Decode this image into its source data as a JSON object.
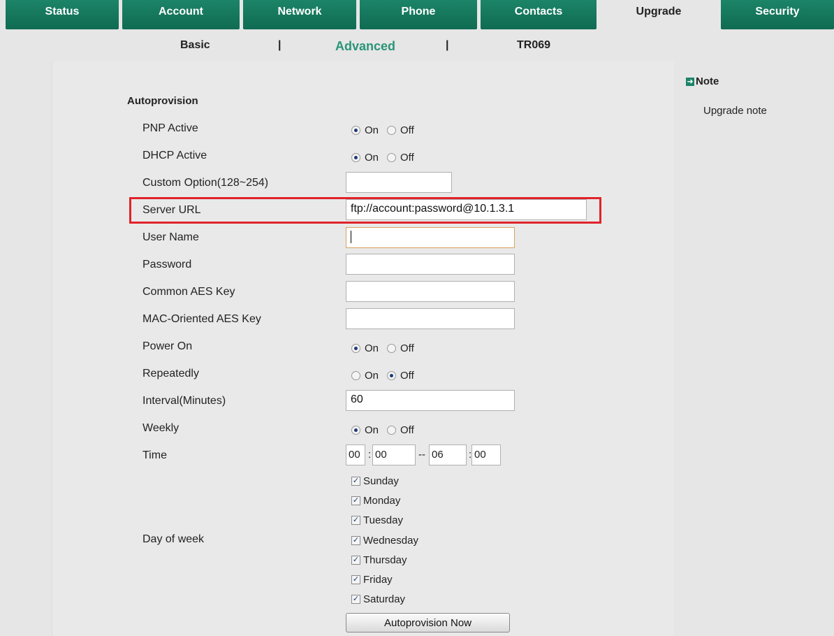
{
  "tabs": [
    {
      "label": "Status"
    },
    {
      "label": "Account"
    },
    {
      "label": "Network"
    },
    {
      "label": "Phone"
    },
    {
      "label": "Contacts"
    },
    {
      "label": "Upgrade",
      "active": true
    },
    {
      "label": "Security"
    }
  ],
  "subnav": {
    "basic": "Basic",
    "sep1": "|",
    "advanced": "Advanced",
    "sep2": "|",
    "tr069": "TR069"
  },
  "section": {
    "title": "Autoprovision"
  },
  "fields": {
    "pnp_active": {
      "label": "PNP Active",
      "value": "On"
    },
    "dhcp_active": {
      "label": "DHCP Active",
      "value": "On"
    },
    "custom_option": {
      "label": "Custom Option(128~254)",
      "value": ""
    },
    "server_url": {
      "label": "Server URL",
      "value": "ftp://account:password@10.1.3.1"
    },
    "user_name": {
      "label": "User Name",
      "value": ""
    },
    "password": {
      "label": "Password",
      "value": ""
    },
    "common_aes": {
      "label": "Common AES Key",
      "value": ""
    },
    "mac_aes": {
      "label": "MAC-Oriented AES Key",
      "value": ""
    },
    "power_on": {
      "label": "Power On",
      "value": "On"
    },
    "repeatedly": {
      "label": "Repeatedly",
      "value": "Off"
    },
    "interval": {
      "label": "Interval(Minutes)",
      "value": "60"
    },
    "weekly": {
      "label": "Weekly",
      "value": "On"
    },
    "time": {
      "label": "Time",
      "start_h": "00",
      "start_m": "00",
      "sep": "--",
      "colon": ":",
      "end_h": "06",
      "end_m": "00"
    },
    "day_of_week": {
      "label": "Day of week"
    }
  },
  "radio_labels": {
    "on": "On",
    "off": "Off"
  },
  "days": [
    {
      "label": "Sunday",
      "checked": true
    },
    {
      "label": "Monday",
      "checked": true
    },
    {
      "label": "Tuesday",
      "checked": true
    },
    {
      "label": "Wednesday",
      "checked": true
    },
    {
      "label": "Thursday",
      "checked": true
    },
    {
      "label": "Friday",
      "checked": true
    },
    {
      "label": "Saturday",
      "checked": true
    }
  ],
  "button": {
    "label": "Autoprovision Now"
  },
  "note": {
    "title": "Note",
    "body": "Upgrade note"
  },
  "colors": {
    "tab_green": "#0f6b52",
    "accent": "#2a9478",
    "highlight": "#e0232b"
  }
}
